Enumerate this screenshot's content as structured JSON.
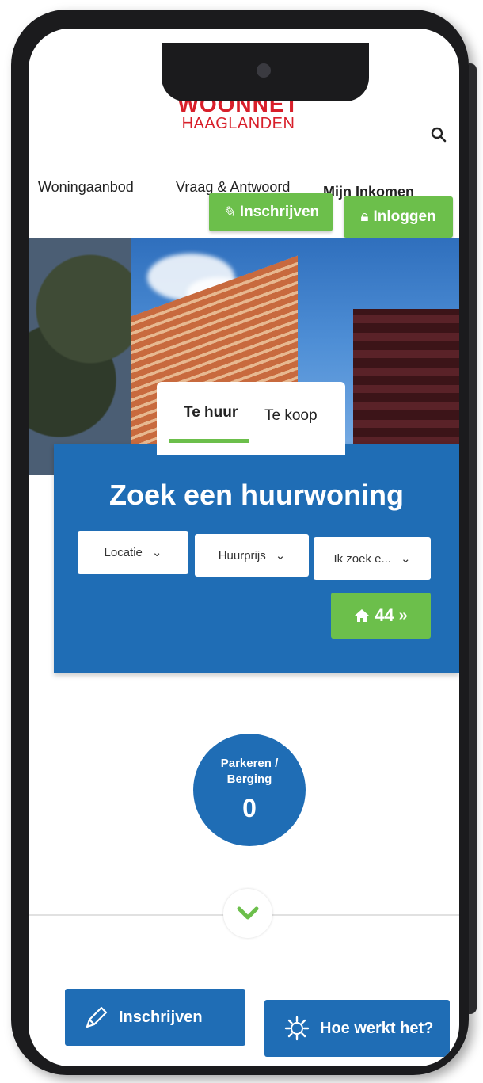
{
  "header": {
    "logo_line1": "WOONNET",
    "logo_line2": "HAAGLANDEN",
    "search_icon": "search-icon"
  },
  "nav": {
    "items": [
      {
        "label": "Woningaanbod"
      },
      {
        "label": "Vraag & Antwoord"
      },
      {
        "label": "Mijn Inkomen"
      }
    ]
  },
  "actions": {
    "register_label": "Inschrijven",
    "login_label": "Inloggen"
  },
  "search_panel": {
    "tabs": [
      {
        "label": "Te huur",
        "active": true
      },
      {
        "label": "Te koop",
        "active": false
      }
    ],
    "title": "Zoek een huurwoning",
    "filters": [
      {
        "label": "Locatie"
      },
      {
        "label": "Huurprijs"
      },
      {
        "label": "Ik zoek e..."
      }
    ],
    "result_count": "44",
    "result_suffix": "»"
  },
  "stats": {
    "label_line1": "Parkeren /",
    "label_line2": "Berging",
    "value": "0"
  },
  "bottom_buttons": {
    "register_label": "Inschrijven",
    "how_label": "Hoe werkt het?"
  },
  "colors": {
    "brand_red": "#d81f2a",
    "green": "#6cbf4b",
    "blue": "#1f6db5"
  }
}
